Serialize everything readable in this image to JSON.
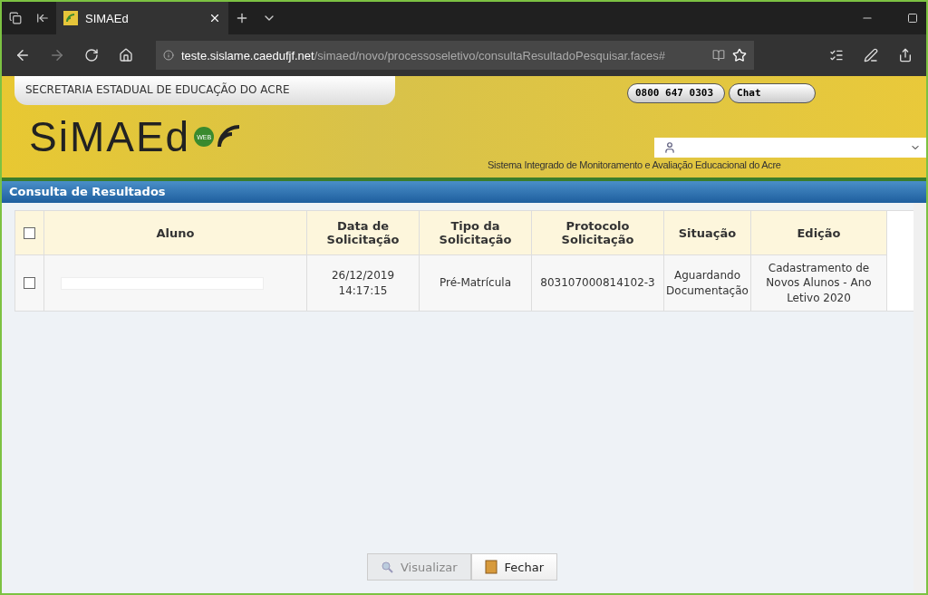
{
  "browser": {
    "tab_title": "SIMAEd",
    "url_domain": "teste.sislame.caedufjf.net",
    "url_path": "/simaed/novo/processoseletivo/consultaResultadoPesquisar.faces#"
  },
  "header": {
    "organization": "SECRETARIA ESTADUAL DE EDUCAÇÃO DO ACRE",
    "phone": "0800 647 0303",
    "chat": "Chat",
    "logo": "SiMAEd",
    "logo_badge": "WEB",
    "subtitle": "Sistema Integrado de Monitoramento e Avaliação Educacional do Acre"
  },
  "page_title": "Consulta de Resultados",
  "table": {
    "columns": [
      "Aluno",
      "Data de Solicitação",
      "Tipo da Solicitação",
      "Protocolo Solicitação",
      "Situação",
      "Edição"
    ],
    "header_checked": false,
    "rows": [
      {
        "checked": false,
        "cells": [
          "",
          "26/12/2019 14:17:15",
          "Pré-Matrícula",
          "803107000814102-3",
          "Aguardando Documentação",
          "Cadastramento de Novos Alunos - Ano Letivo 2020"
        ]
      }
    ]
  },
  "buttons": [
    {
      "label": "Visualizar",
      "kind": "view",
      "disabled": true
    },
    {
      "label": "Fechar",
      "kind": "close",
      "disabled": false
    }
  ]
}
